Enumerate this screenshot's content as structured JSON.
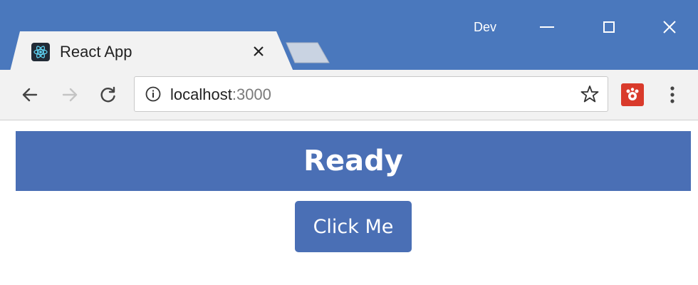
{
  "window": {
    "profile_label": "Dev",
    "accent_color": "#4a78bd"
  },
  "tab": {
    "title": "React App",
    "favicon": "react-logo-icon",
    "close": "close-icon"
  },
  "toolbar": {
    "back": "arrow-left-icon",
    "forward": "arrow-right-icon",
    "reload": "reload-icon",
    "url_host": "localhost",
    "url_port": ":3000",
    "bookmark": "star-icon",
    "extension": "extension-icon",
    "menu": "kebab-menu-icon"
  },
  "page": {
    "banner_text": "Ready",
    "button_label": "Click Me",
    "primary_color": "#4a6fb5"
  }
}
